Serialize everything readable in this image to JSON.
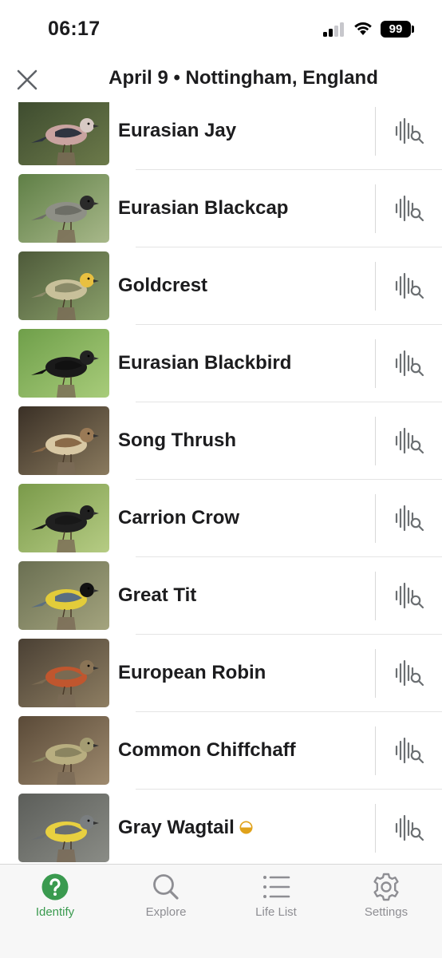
{
  "status_bar": {
    "time": "06:17",
    "battery": "99"
  },
  "header": {
    "title": "April 9 • Nottingham, England",
    "close_icon": "close-icon"
  },
  "birds": [
    {
      "name": "Eurasian Jay",
      "badge": null
    },
    {
      "name": "Eurasian Blackcap",
      "badge": null
    },
    {
      "name": "Goldcrest",
      "badge": null
    },
    {
      "name": "Eurasian Blackbird",
      "badge": null
    },
    {
      "name": "Song Thrush",
      "badge": null
    },
    {
      "name": "Carrion Crow",
      "badge": null
    },
    {
      "name": "Great Tit",
      "badge": null
    },
    {
      "name": "European Robin",
      "badge": null
    },
    {
      "name": "Common Chiffchaff",
      "badge": null
    },
    {
      "name": "Gray Wagtail",
      "badge": "half-circle-badge-icon"
    }
  ],
  "row_action_icon": "sound-search-icon",
  "tabs": [
    {
      "label": "Identify",
      "icon": "question-circle-icon",
      "active": true
    },
    {
      "label": "Explore",
      "icon": "search-icon",
      "active": false
    },
    {
      "label": "Life List",
      "icon": "list-icon",
      "active": false
    },
    {
      "label": "Settings",
      "icon": "gear-icon",
      "active": false
    }
  ],
  "colors": {
    "accent": "#3a9a4f",
    "tab_inactive": "#8e8e93",
    "badge": "#e0a21a"
  }
}
